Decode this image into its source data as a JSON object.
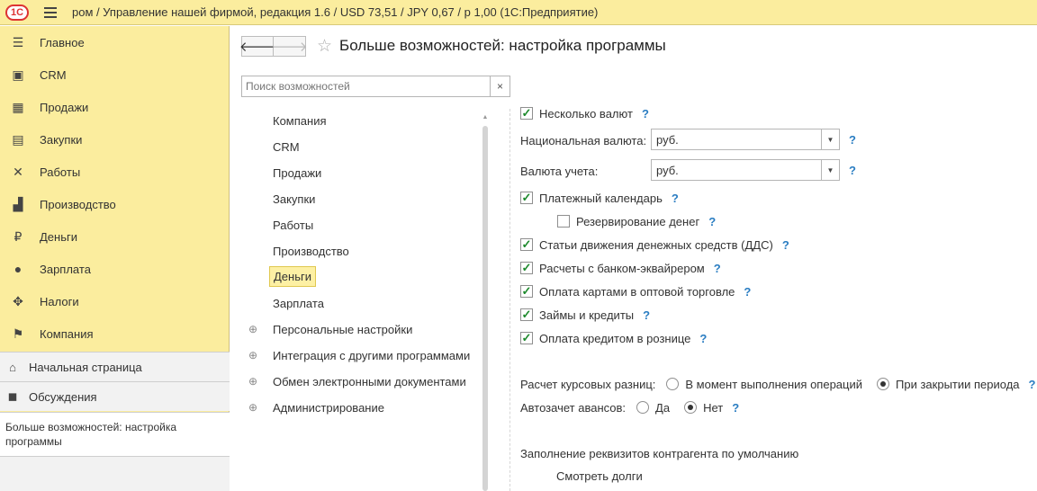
{
  "window": {
    "title": "ром / Управление нашей фирмой, редакция 1.6 / USD 73,51 / JPY 0,67 / р 1,00  (1С:Предприятие)",
    "logo_text": "1С"
  },
  "sidebar": {
    "items": [
      {
        "label": "Главное",
        "icon": "menu-lines-icon"
      },
      {
        "label": "CRM",
        "icon": "contact-card-icon"
      },
      {
        "label": "Продажи",
        "icon": "basket-icon"
      },
      {
        "label": "Закупки",
        "icon": "cart-icon"
      },
      {
        "label": "Работы",
        "icon": "tools-icon"
      },
      {
        "label": "Производство",
        "icon": "factory-icon"
      },
      {
        "label": "Деньги",
        "icon": "ruble-coin-icon"
      },
      {
        "label": "Зарплата",
        "icon": "people-icon"
      },
      {
        "label": "Налоги",
        "icon": "eagle-emblem-icon"
      },
      {
        "label": "Компания",
        "icon": "flag-icon"
      }
    ],
    "home": "Начальная страница",
    "discussions": "Обсуждения",
    "open_window": "Больше возможностей: настройка программы"
  },
  "main": {
    "title": "Больше возможностей: настройка программы",
    "search_placeholder": "Поиск возможностей",
    "clear_symbol": "×",
    "sections": [
      {
        "label": "Компания",
        "expandable": false
      },
      {
        "label": "CRM",
        "expandable": false
      },
      {
        "label": "Продажи",
        "expandable": false
      },
      {
        "label": "Закупки",
        "expandable": false
      },
      {
        "label": "Работы",
        "expandable": false
      },
      {
        "label": "Производство",
        "expandable": false
      },
      {
        "label": "Деньги",
        "expandable": false,
        "active": true
      },
      {
        "label": "Зарплата",
        "expandable": false
      },
      {
        "label": "Персональные настройки",
        "expandable": true
      },
      {
        "label": "Интеграция с другими программами",
        "expandable": true
      },
      {
        "label": "Обмен электронными документами",
        "expandable": true
      },
      {
        "label": "Администрирование",
        "expandable": true
      }
    ]
  },
  "settings": {
    "multi_currency": {
      "label": "Несколько валют",
      "checked": true
    },
    "national_currency": {
      "label": "Национальная валюта:",
      "value": "руб."
    },
    "accounting_currency": {
      "label": "Валюта учета:",
      "value": "руб."
    },
    "payment_calendar": {
      "label": "Платежный календарь",
      "checked": true
    },
    "money_reservation": {
      "label": "Резервирование денег",
      "checked": false
    },
    "cash_flow_items": {
      "label": "Статьи движения денежных средств (ДДС)",
      "checked": true
    },
    "acquiring": {
      "label": "Расчеты с банком-эквайрером",
      "checked": true
    },
    "wholesale_cards": {
      "label": "Оплата картами в оптовой торговле",
      "checked": true
    },
    "loans": {
      "label": "Займы и кредиты",
      "checked": true
    },
    "retail_credit": {
      "label": "Оплата кредитом в рознице",
      "checked": true
    },
    "exchange_diff": {
      "label": "Расчет курсовых разниц:",
      "option1": "В момент выполнения операций",
      "option2": "При закрытии периода",
      "selected": "option2"
    },
    "advance_offset": {
      "label": "Автозачет авансов:",
      "option1": "Да",
      "option2": "Нет",
      "selected": "option2"
    },
    "counterparty_defaults": "Заполнение реквизитов контрагента по умолчанию",
    "view_debts": "Смотреть долги",
    "help_symbol": "?",
    "check_symbol": "✓"
  }
}
